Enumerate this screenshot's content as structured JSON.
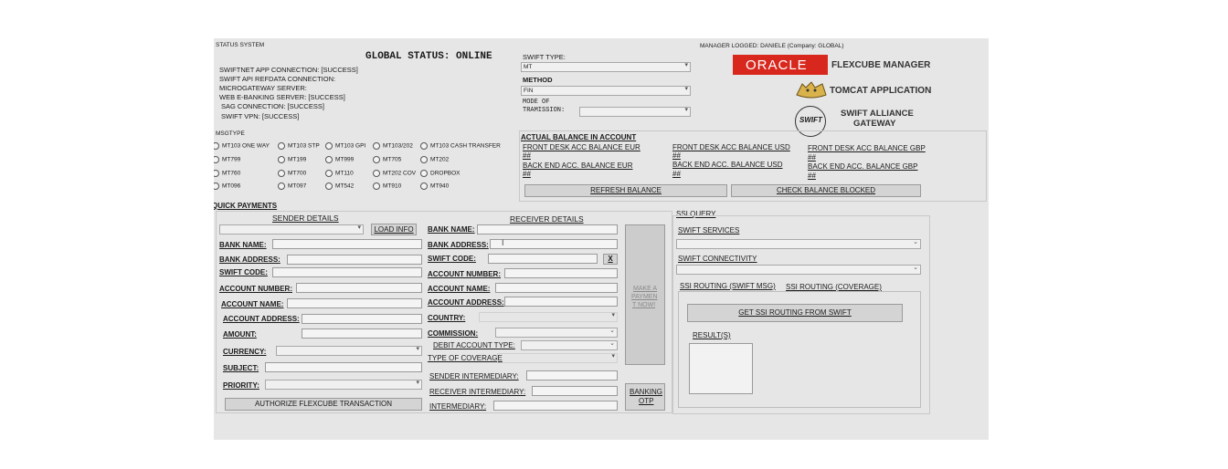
{
  "status": {
    "title": "STATUS SYSTEM",
    "global": "GLOBAL STATUS: ONLINE",
    "lines": [
      "SWIFTNET APP CONNECTION: [SUCCESS]",
      "SWIFT API REFDATA CONNECTION:",
      "MICROGATEWAY SERVER:",
      "WEB E-BANKING SERVER: [SUCCESS]",
      "SAG CONNECTION: [SUCCESS]",
      "SWIFT VPN: [SUCCESS]"
    ]
  },
  "swift": {
    "type_label": "SWIFT TYPE:",
    "type_value": "MT",
    "method_label": "METHOD",
    "method_value": "FIN",
    "mode_label": "MODE OF",
    "tramission_label": "TRAMISSION:"
  },
  "manager": "MANAGER LOGGED: DANIELE (Company: GLOBAL)",
  "brands": {
    "oracle": "ORACLE",
    "flexcube": "FLEXCUBE MANAGER",
    "tomcat": "TOMCAT APPLICATION",
    "swift_logo": "SWIFT",
    "alliance": "SWIFT ALLIANCE",
    "gateway": "GATEWAY"
  },
  "msgtype": {
    "label": "MSGTYPE",
    "rows": [
      [
        "MT103 ONE WAY",
        "MT103 STP",
        "MT103 GPI",
        "MT103/202",
        "MT103 CASH TRANSFER"
      ],
      [
        "MT799",
        "MT199",
        "MT999",
        "MT705",
        "MT202"
      ],
      [
        "MT760",
        "MT700",
        "MT110",
        "MT202 COV",
        "DROPBOX"
      ],
      [
        "MT096",
        "MT097",
        "MT542",
        "MT910",
        "MT940"
      ]
    ]
  },
  "balance": {
    "title": "ACTUAL BALANCE IN ACCOUNT",
    "front_eur": "FRONT DESK ACC BALANCE EUR",
    "front_usd": "FRONT DESK ACC BALANCE USD",
    "front_gbp": "FRONT DESK ACC BALANCE GBP",
    "back_eur": "BACK END ACC. BALANCE EUR",
    "back_usd": "BACK END ACC. BALANCE USD",
    "back_gbp": "BACK END ACC. BALANCE GBP",
    "hash": "##",
    "refresh": "REFRESH BALANCE",
    "check": "CHECK BALANCE BLOCKED"
  },
  "quick": {
    "title": "QUICK PAYMENTS",
    "sender_title": "SENDER DETAILS",
    "load_info": "LOAD INFO",
    "bank_name": "BANK NAME:",
    "bank_address": "BANK ADDRESS:",
    "swift_code": "SWIFT CODE:",
    "account_number": "ACCOUNT NUMBER:",
    "account_name": "ACCOUNT NAME:",
    "account_address": "ACCOUNT ADDRESS:",
    "amount": "AMOUNT:",
    "currency": "CURRENCY:",
    "subject": "SUBJECT:",
    "priority": "PRIORITY:",
    "authorize": "AUTHORIZE FLEXCUBE TRANSACTION"
  },
  "receiver": {
    "title": "RECEIVER DETAILS",
    "bank_name": "BANK NAME:",
    "bank_address": "BANK ADDRESS:",
    "swift_code": "SWIFT CODE:",
    "clear": "X",
    "account_number": "ACCOUNT NUMBER:",
    "account_name": "ACCOUNT NAME:",
    "account_address": "ACCOUNT ADDRESS:",
    "country": "COUNTRY:",
    "commission": "COMMISSION:",
    "debit_account_type": "DEBIT ACCOUNT TYPE:",
    "type_of_coverage": "TYPE OF COVERAGE",
    "sender_intermediary": "SENDER INTERMEDIARY:",
    "receiver_intermediary": "RECEIVER INTERMEDIARY:",
    "intermediary": "INTERMEDIARY:",
    "make_payment_1": "MAKE A",
    "make_payment_2": "PAYMEN",
    "make_payment_3": "T NOW!",
    "banking_1": "BANKING",
    "banking_2": "OTP"
  },
  "ssi": {
    "title": "SSI QUERY",
    "services": "SWIFT SERVICES",
    "connectivity": "SWIFT CONNECTIVITY",
    "tab_msg": "SSI ROUTING (SWIFT MSG)",
    "tab_coverage": "SSI ROUTING (COVERAGE)",
    "get_button": "GET SSI ROUTING FROM SWIFT",
    "results": "RESULT(S)"
  },
  "colors": {
    "oracle_red": "#d8281e",
    "panel": "#e6e6e6"
  }
}
